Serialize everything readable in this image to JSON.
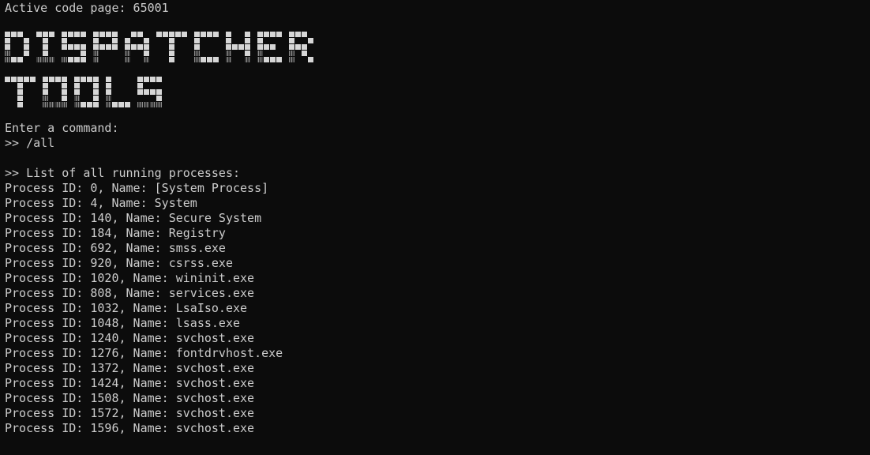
{
  "terminal": {
    "code_page_line": "Active code page: 65001",
    "banner": {
      "line1": "DISPATCHER",
      "line2": "TOOLS"
    },
    "prompt": "Enter a command:",
    "command": ">> /all",
    "list_header": ">> List of all running processes:",
    "processes": [
      "Process ID: 0, Name: [System Process]",
      "Process ID: 4, Name: System",
      "Process ID: 140, Name: Secure System",
      "Process ID: 184, Name: Registry",
      "Process ID: 692, Name: smss.exe",
      "Process ID: 920, Name: csrss.exe",
      "Process ID: 1020, Name: wininit.exe",
      "Process ID: 808, Name: services.exe",
      "Process ID: 1032, Name: LsaIso.exe",
      "Process ID: 1048, Name: lsass.exe",
      "Process ID: 1240, Name: svchost.exe",
      "Process ID: 1276, Name: fontdrvhost.exe",
      "Process ID: 1372, Name: svchost.exe",
      "Process ID: 1424, Name: svchost.exe",
      "Process ID: 1508, Name: svchost.exe",
      "Process ID: 1572, Name: svchost.exe",
      "Process ID: 1596, Name: svchost.exe"
    ]
  },
  "colors": {
    "background": "#0c0c0c",
    "text": "#cccccc",
    "banner_light": "#d6d6d6",
    "banner_shade": "#8a8a8a"
  }
}
